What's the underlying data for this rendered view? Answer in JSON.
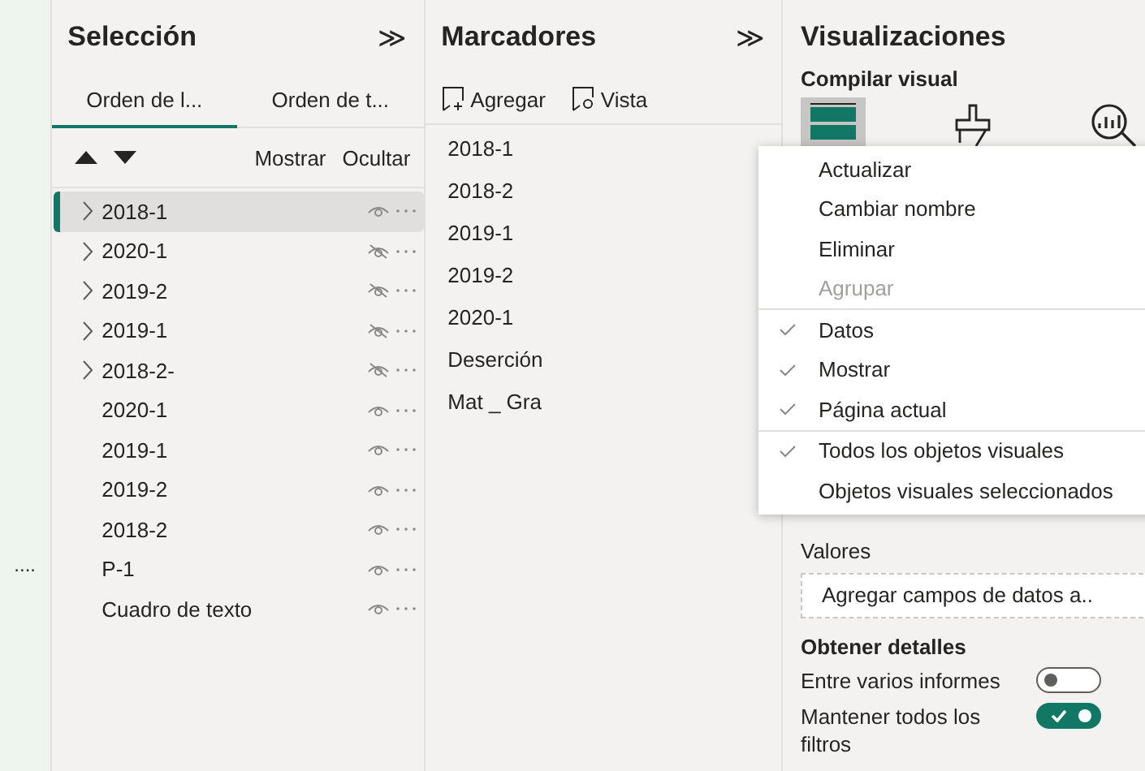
{
  "left_strip": {
    "handle": "...."
  },
  "selection": {
    "title": "Selección",
    "collapse": "≫",
    "tabs": [
      {
        "label": "Orden de l...",
        "selected": true
      },
      {
        "label": "Orden de t...",
        "selected": false
      }
    ],
    "show_label": "Mostrar",
    "hide_label": "Ocultar",
    "items": [
      {
        "label": "2018-1",
        "expandable": true,
        "hidden": false,
        "selected": true
      },
      {
        "label": "2020-1",
        "expandable": true,
        "hidden": true,
        "selected": false
      },
      {
        "label": "2019-2",
        "expandable": true,
        "hidden": true,
        "selected": false
      },
      {
        "label": "2019-1",
        "expandable": true,
        "hidden": true,
        "selected": false
      },
      {
        "label": "2018-2-",
        "expandable": true,
        "hidden": true,
        "selected": false
      },
      {
        "label": "2020-1",
        "expandable": false,
        "hidden": false,
        "selected": false
      },
      {
        "label": "2019-1",
        "expandable": false,
        "hidden": false,
        "selected": false
      },
      {
        "label": "2019-2",
        "expandable": false,
        "hidden": false,
        "selected": false
      },
      {
        "label": "2018-2",
        "expandable": false,
        "hidden": false,
        "selected": false
      },
      {
        "label": "P-1",
        "expandable": false,
        "hidden": false,
        "selected": false
      },
      {
        "label": "Cuadro de texto",
        "expandable": false,
        "hidden": false,
        "selected": false
      }
    ]
  },
  "bookmarks": {
    "title": "Marcadores",
    "collapse": "≫",
    "add_label": "Agregar",
    "view_label": "Vista",
    "items": [
      "2018-1",
      "2018-2",
      "2019-1",
      "2019-2",
      "2020-1",
      "Deserción",
      "Mat _ Gra"
    ]
  },
  "visualizations": {
    "title": "Visualizaciones",
    "section": "Compilar visual",
    "values_label": "Valores",
    "values_placeholder": "Agregar campos de datos a..",
    "details_title": "Obtener detalles",
    "toggles": [
      {
        "label": "Entre varios informes",
        "on": false
      },
      {
        "label": "Mantener todos los filtros",
        "on": true
      }
    ]
  },
  "context_menu": {
    "sections": [
      [
        {
          "label": "Actualizar",
          "checked": false,
          "disabled": false
        },
        {
          "label": "Cambiar nombre",
          "checked": false,
          "disabled": false
        },
        {
          "label": "Eliminar",
          "checked": false,
          "disabled": false
        },
        {
          "label": "Agrupar",
          "checked": false,
          "disabled": true
        }
      ],
      [
        {
          "label": "Datos",
          "checked": true,
          "disabled": false
        },
        {
          "label": "Mostrar",
          "checked": true,
          "disabled": false
        },
        {
          "label": "Página actual",
          "checked": true,
          "disabled": false
        }
      ],
      [
        {
          "label": "Todos los objetos visuales",
          "checked": true,
          "disabled": false
        },
        {
          "label": "Objetos visuales seleccionados",
          "checked": false,
          "disabled": false
        }
      ]
    ]
  }
}
